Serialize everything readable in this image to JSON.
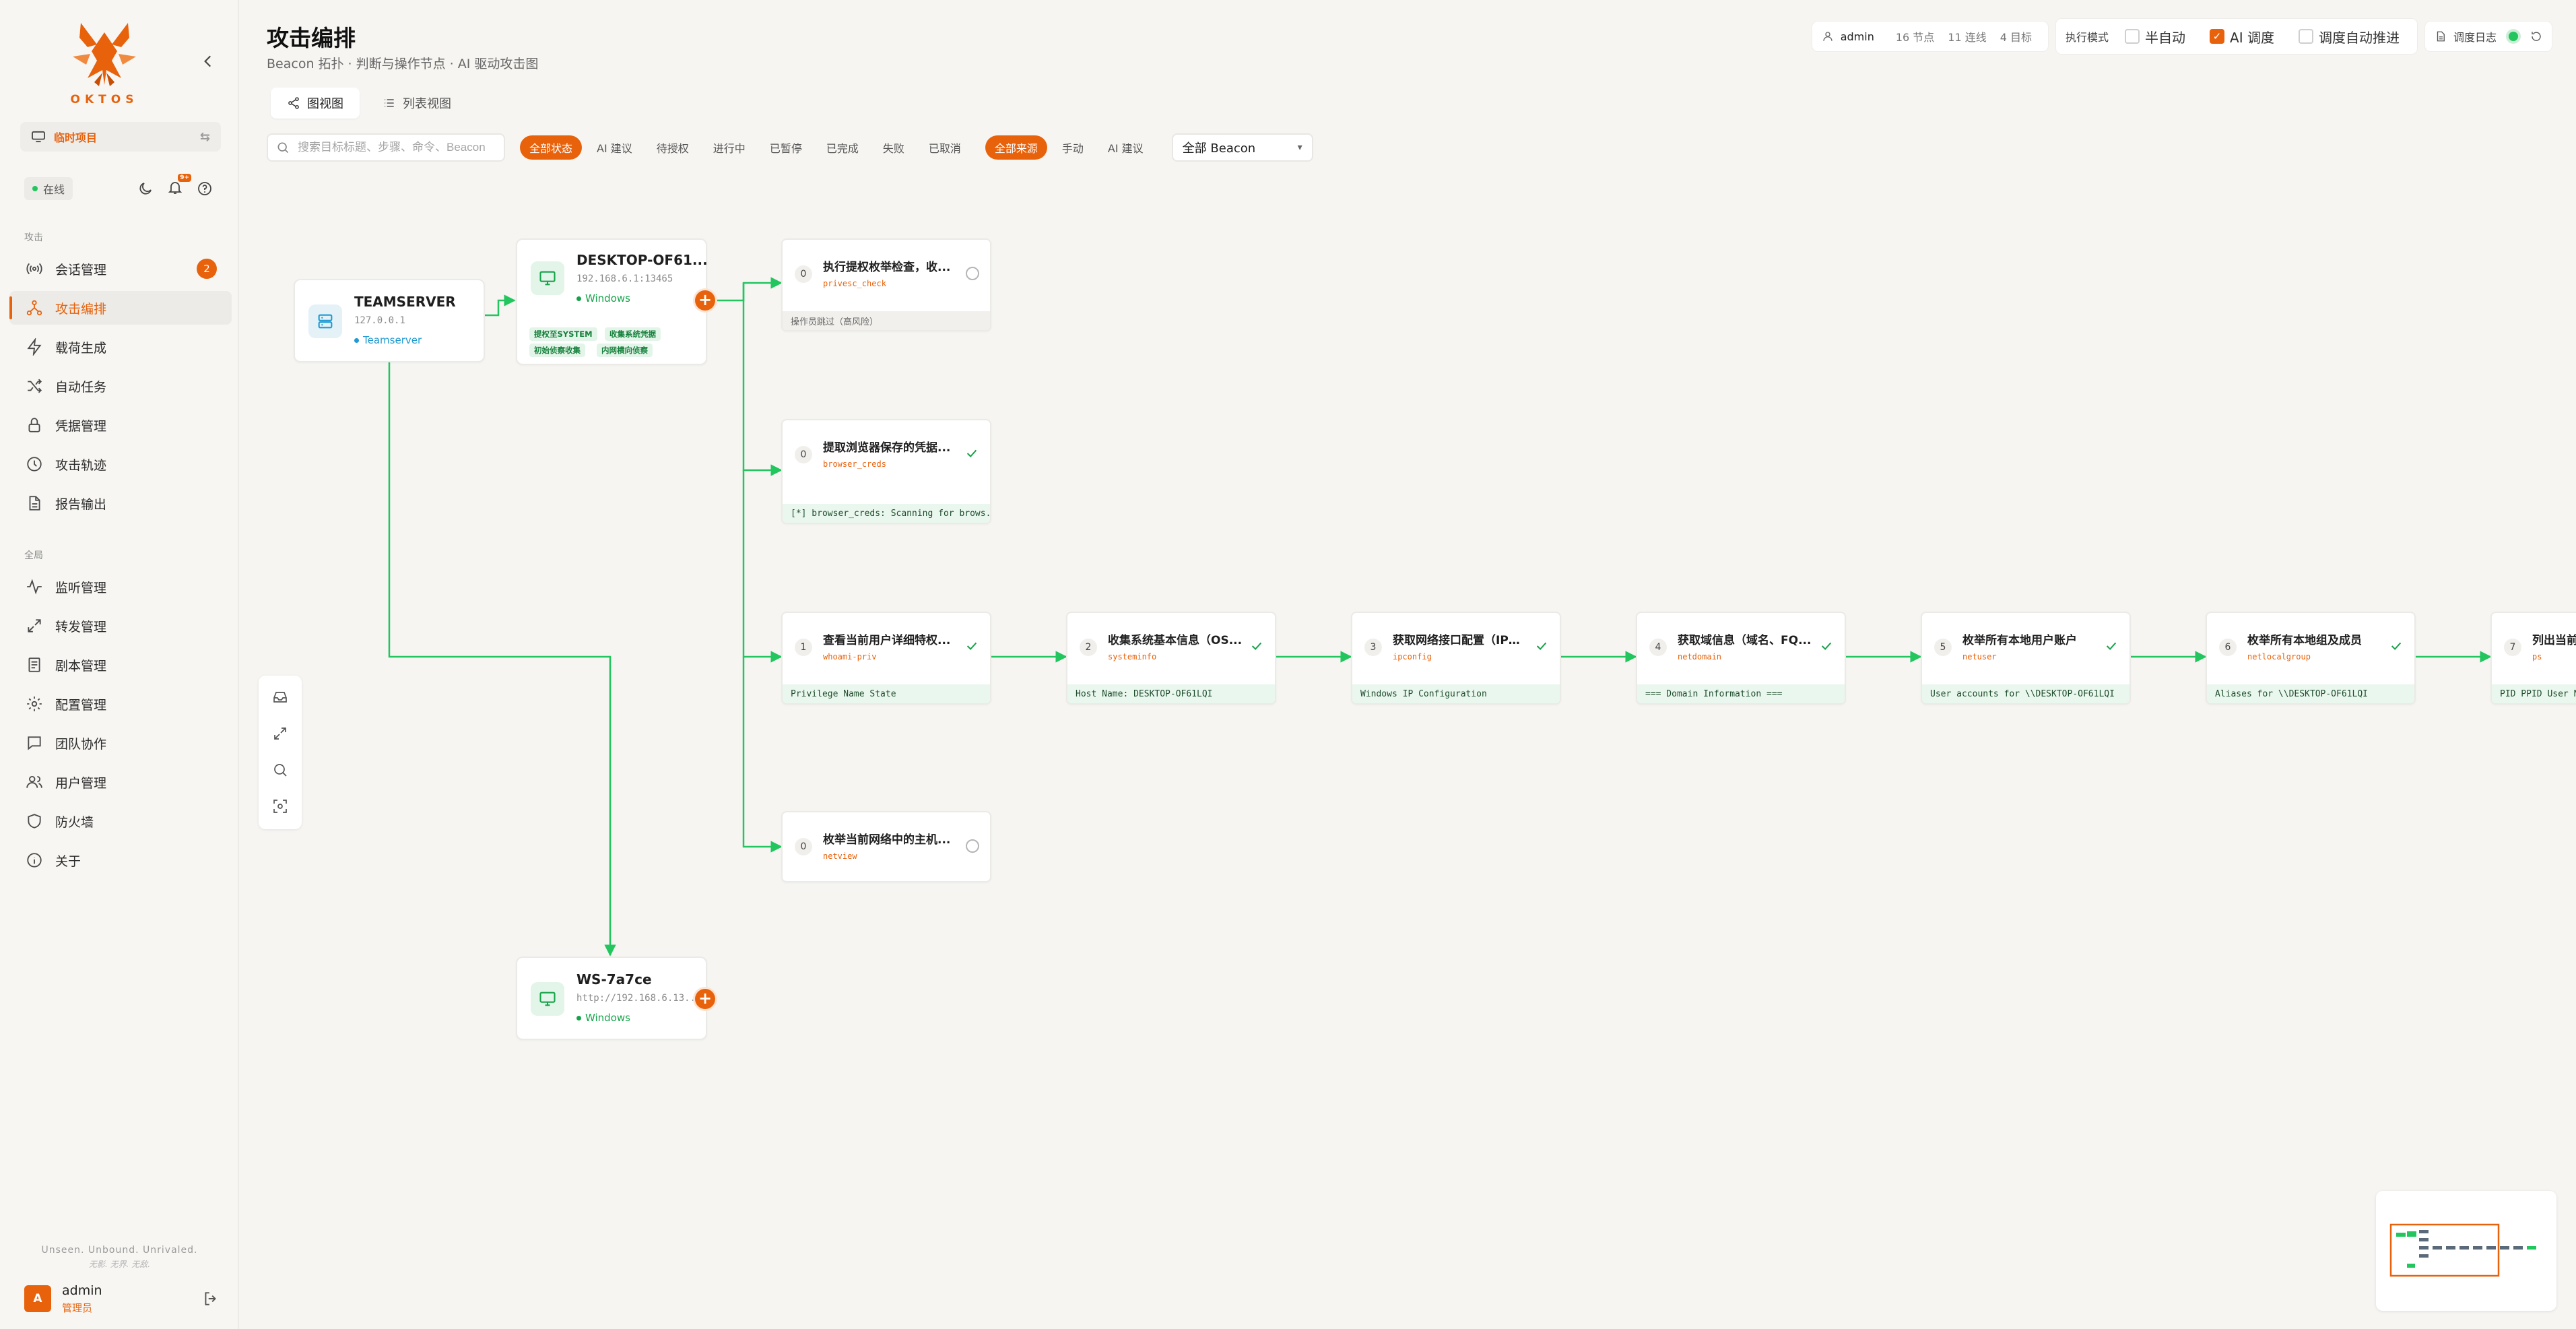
{
  "brand": {
    "name": "OKTOS"
  },
  "sidebar": {
    "project_label": "临时项目",
    "status_label": "在线",
    "notif_badge": "9+",
    "groups": [
      "攻击",
      "全局"
    ],
    "attack_items": [
      {
        "label": "会话管理",
        "icon": "signal-icon",
        "badge": "2"
      },
      {
        "label": "攻击编排",
        "icon": "topology-icon",
        "active": true
      },
      {
        "label": "载荷生成",
        "icon": "lightning-icon"
      },
      {
        "label": "自动任务",
        "icon": "shuffle-icon"
      },
      {
        "label": "凭据管理",
        "icon": "lock-icon"
      },
      {
        "label": "攻击轨迹",
        "icon": "clock-icon"
      },
      {
        "label": "报告输出",
        "icon": "document-icon"
      }
    ],
    "global_items": [
      {
        "label": "监听管理",
        "icon": "pulse-icon"
      },
      {
        "label": "转发管理",
        "icon": "arrows-icon"
      },
      {
        "label": "剧本管理",
        "icon": "playbook-icon"
      },
      {
        "label": "配置管理",
        "icon": "gear-icon"
      },
      {
        "label": "团队协作",
        "icon": "chat-icon"
      },
      {
        "label": "用户管理",
        "icon": "users-icon"
      },
      {
        "label": "防火墙",
        "icon": "shield-icon"
      },
      {
        "label": "关于",
        "icon": "info-icon"
      }
    ],
    "slogan": "Unseen. Unbound. Unrivaled.",
    "slogan_sub": "无影. 无界. 无敌.",
    "user": {
      "initial": "A",
      "name": "admin",
      "role": "管理员"
    }
  },
  "header": {
    "title": "攻击编排",
    "subtitle": "Beacon 拓扑 · 判断与操作节点 · AI 驱动攻击图",
    "user": "admin",
    "stats": {
      "nodes": "16 节点",
      "edges": "11 连线",
      "targets": "4 目标"
    },
    "mode_label": "执行模式",
    "modes": [
      {
        "label": "半自动",
        "checked": false
      },
      {
        "label": "AI 调度",
        "checked": true
      }
    ],
    "auto_advance": {
      "label": "调度自动推进",
      "checked": false
    },
    "log_label": "调度日志"
  },
  "tabs": [
    {
      "label": "图视图",
      "active": true
    },
    {
      "label": "列表视图",
      "active": false
    }
  ],
  "filters": {
    "search_placeholder": "搜索目标标题、步骤、命令、Beacon",
    "status_chips": [
      "全部状态",
      "AI 建议",
      "待授权",
      "进行中",
      "已暂停",
      "已完成",
      "失败",
      "已取消"
    ],
    "source_chips": [
      "全部来源",
      "手动",
      "AI 建议"
    ],
    "beacon_select": "全部 Beacon"
  },
  "graph": {
    "teamserver": {
      "name": "TEAMSERVER",
      "ip": "127.0.0.1",
      "type": "Teamserver"
    },
    "beacons": [
      {
        "name": "DESKTOP-OF61...",
        "ip": "192.168.6.1:13465",
        "os": "Windows",
        "tags": [
          "提权至SYSTEM",
          "收集系统凭据",
          "初始侦察收集",
          "内网横向侦察"
        ]
      },
      {
        "name": "WS-7a7ce",
        "ip": "http://192.168.6.13...",
        "os": "Windows",
        "tags": []
      }
    ],
    "branch_tasks": [
      {
        "num": "0",
        "title": "执行提权枚举检查，收...",
        "cmd": "privesc_check",
        "status": "pending",
        "output": "操作员跳过（高风险）",
        "output_style": "skip"
      },
      {
        "num": "0",
        "title": "提取浏览器保存的凭据...",
        "cmd": "browser_creds",
        "status": "done",
        "output": "[*] browser_creds: Scanning for brows...",
        "output_style": "ok"
      },
      {
        "num": "0",
        "title": "枚举当前网络中的主机...",
        "cmd": "netview",
        "status": "pending",
        "output": "",
        "output_style": ""
      }
    ],
    "chain_tasks": [
      {
        "num": "1",
        "title": "查看当前用户详细特权...",
        "cmd": "whoami-priv",
        "output": "Privilege Name State"
      },
      {
        "num": "2",
        "title": "收集系统基本信息（OS...",
        "cmd": "systeminfo",
        "output": "Host Name: DESKTOP-OF61LQI"
      },
      {
        "num": "3",
        "title": "获取网络接口配置（IP、...",
        "cmd": "ipconfig",
        "output": "Windows IP Configuration"
      },
      {
        "num": "4",
        "title": "获取域信息（域名、FQ...",
        "cmd": "netdomain",
        "output": "=== Domain Information ==="
      },
      {
        "num": "5",
        "title": "枚举所有本地用户账户",
        "cmd": "netuser",
        "output": "User accounts for \\\\DESKTOP-OF61LQI"
      },
      {
        "num": "6",
        "title": "枚举所有本地组及成员",
        "cmd": "netlocalgroup",
        "output": "Aliases for \\\\DESKTOP-OF61LQI"
      },
      {
        "num": "7",
        "title": "列出当前进程",
        "cmd": "ps",
        "output": "PID PPID User Name"
      }
    ]
  },
  "colors": {
    "accent": "#e8620c",
    "edge": "#22c55e",
    "teamserver": "#1f9bd1",
    "ok": "#16a34a"
  }
}
